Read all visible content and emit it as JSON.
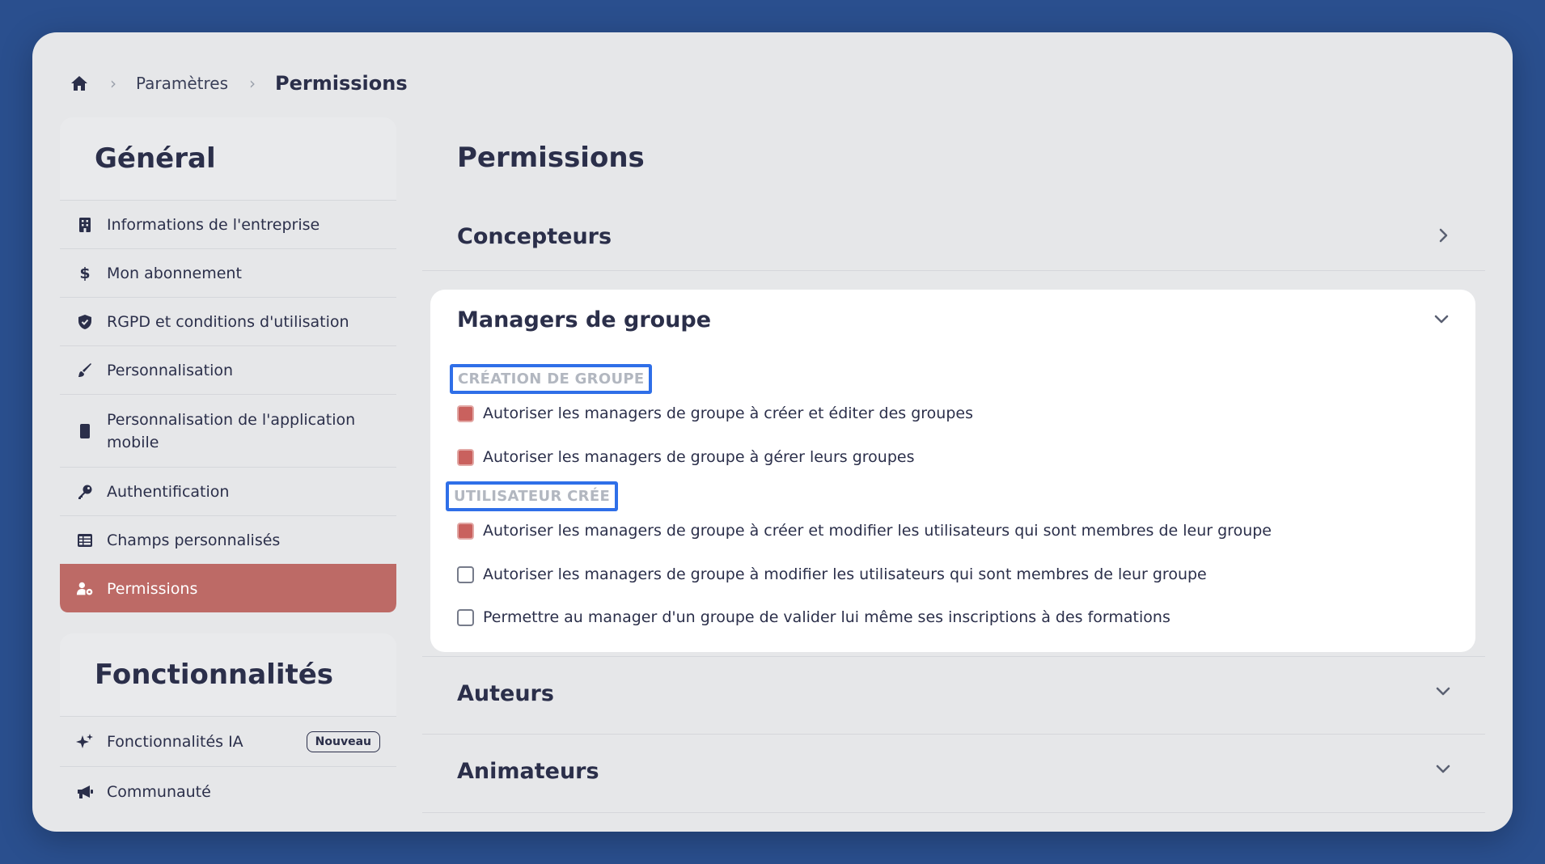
{
  "breadcrumb": {
    "home_icon": "home-icon",
    "items": [
      "Paramètres",
      "Permissions"
    ]
  },
  "sidebar": {
    "general": {
      "title": "Général",
      "items": [
        {
          "label": "Informations de l'entreprise",
          "icon": "building-icon"
        },
        {
          "label": "Mon abonnement",
          "icon": "dollar-icon"
        },
        {
          "label": "RGPD et conditions d'utilisation",
          "icon": "shield-icon"
        },
        {
          "label": "Personnalisation",
          "icon": "brush-icon"
        },
        {
          "label": "Personnalisation de l'application mobile",
          "icon": "mobile-icon"
        },
        {
          "label": "Authentification",
          "icon": "key-icon"
        },
        {
          "label": "Champs personnalisés",
          "icon": "table-icon"
        },
        {
          "label": "Permissions",
          "icon": "user-gear-icon",
          "active": true
        }
      ]
    },
    "features": {
      "title": "Fonctionnalités",
      "items": [
        {
          "label": "Fonctionnalités IA",
          "icon": "sparkle-icon",
          "badge": "Nouveau"
        },
        {
          "label": "Communauté",
          "icon": "megaphone-icon"
        }
      ]
    }
  },
  "main": {
    "title": "Permissions",
    "sections": {
      "concepteurs": {
        "title": "Concepteurs"
      },
      "managers": {
        "title": "Managers de groupe",
        "groups": [
          {
            "heading": "CRÉATION DE GROUPE",
            "options": [
              {
                "label": "Autoriser les managers de groupe à créer et éditer des groupes",
                "checked": true
              },
              {
                "label": "Autoriser les managers de groupe à gérer leurs groupes",
                "checked": true
              }
            ]
          },
          {
            "heading": "UTILISATEUR CRÉE",
            "options": [
              {
                "label": "Autoriser les managers de groupe à créer et modifier les utilisateurs qui sont membres de leur groupe",
                "checked": true
              },
              {
                "label": "Autoriser les managers de groupe à modifier les utilisateurs qui sont membres de leur groupe",
                "checked": false
              },
              {
                "label": "Permettre au manager d'un groupe de valider lui même ses inscriptions à des formations",
                "checked": false
              }
            ]
          }
        ]
      },
      "auteurs": {
        "title": "Auteurs"
      },
      "animateurs": {
        "title": "Animateurs"
      }
    }
  },
  "colors": {
    "accent": "#bd6a66",
    "checkbox_on": "#c9615e",
    "highlight_border": "#2f6fe8",
    "background": "#2a4f8e"
  }
}
